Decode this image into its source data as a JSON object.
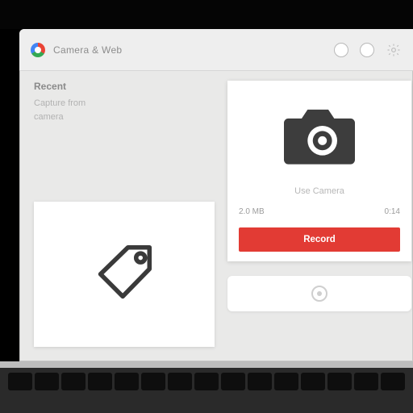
{
  "titlebar": {
    "tab_title": "Camera & Web"
  },
  "sidebar": {
    "heading": "Recent",
    "line1": "Capture from",
    "line2": "camera"
  },
  "capture": {
    "caption": "Use Camera",
    "size_label": "2.0 MB",
    "duration_label": "0:14",
    "button_label": "Record"
  },
  "colors": {
    "accent_red": "#e23b34",
    "icon_dark": "#3d3d3d"
  }
}
